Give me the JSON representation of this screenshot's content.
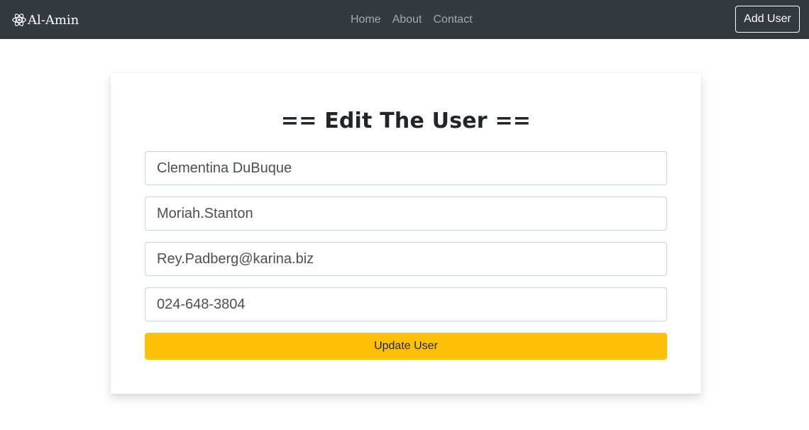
{
  "navbar": {
    "brand": "Al-Amin",
    "brand_icon": "react-atom-icon",
    "links": [
      {
        "label": "Home"
      },
      {
        "label": "About"
      },
      {
        "label": "Contact"
      }
    ],
    "add_user_label": "Add User",
    "background": "#343a40"
  },
  "form": {
    "title": "== Edit The User ==",
    "fields": {
      "name": "Clementina DuBuque",
      "username": "Moriah.Stanton",
      "email": "Rey.Padberg@karina.biz",
      "phone": "024-648-3804"
    },
    "submit_label": "Update User",
    "submit_color": "#ffc107"
  }
}
